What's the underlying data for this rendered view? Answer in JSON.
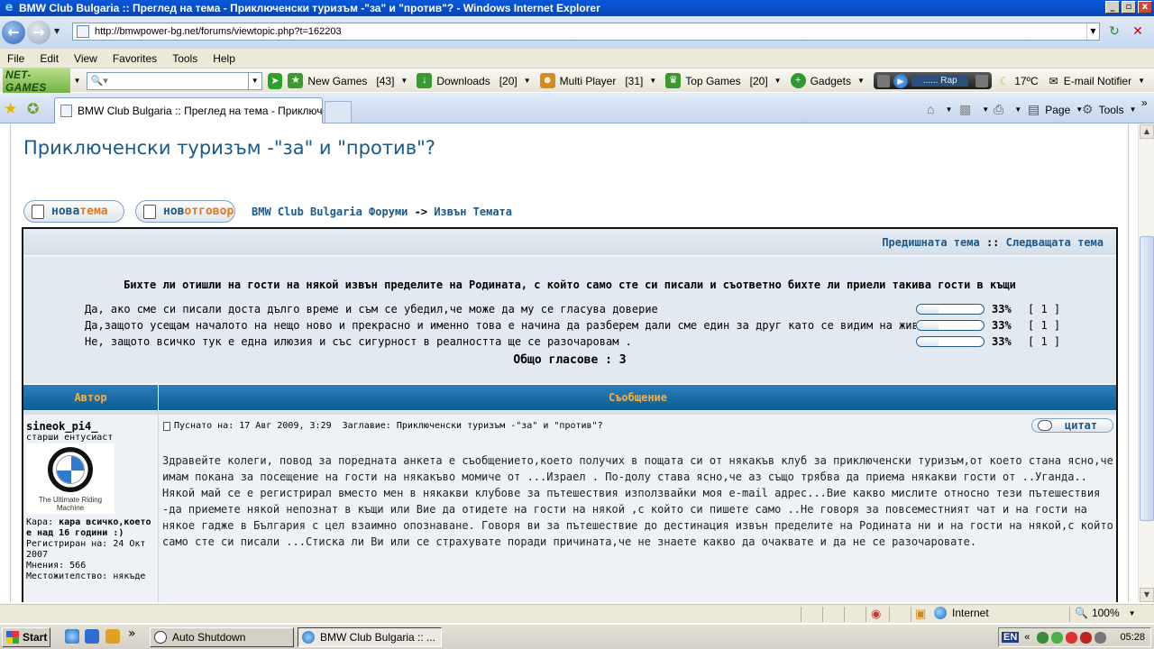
{
  "window": {
    "title": "BMW Club Bulgaria :: Преглед на тема - Приключенски туризъм -\"за\" и \"против\"? - Windows Internet Explorer",
    "controls": [
      "_",
      "▫",
      "x"
    ]
  },
  "address_bar": {
    "url": "http://bmwpower-bg.net/forums/viewtopic.php?t=162203"
  },
  "menu": [
    "File",
    "Edit",
    "View",
    "Favorites",
    "Tools",
    "Help"
  ],
  "toolbar": {
    "brand": "NET-GAMES",
    "search_placeholder": "",
    "items": [
      {
        "label": "New Games",
        "count": "[43]",
        "icon": "new-games-icon",
        "color": "#3b9a2f"
      },
      {
        "label": "Downloads",
        "count": "[20]",
        "icon": "downloads-icon",
        "color": "#3b9a2f"
      },
      {
        "label": "Multi Player",
        "count": "[31]",
        "icon": "multiplayer-icon",
        "color": "#d98a1c"
      },
      {
        "label": "Top Games",
        "count": "[20]",
        "icon": "top-games-icon",
        "color": "#3b9a2f"
      }
    ],
    "gadgets_label": "Gadgets",
    "player_station": "...... Rap",
    "weather": "17ºC",
    "email_label": "E-mail Notifier"
  },
  "tabs": [
    {
      "label": "BMW Club Bulgaria :: Преглед на тема - Приключен..."
    }
  ],
  "command_bar": {
    "page_label": "Page",
    "tools_label": "Tools"
  },
  "forum": {
    "topic_title": "Приключенски туризъм -\"за\" и \"против\"?",
    "new_topic": {
      "part1": "нова",
      "part2": "тема"
    },
    "reply": {
      "part1": "нов",
      "part2": "отговор"
    },
    "breadcrumb_forum": "BMW Club Bulgaria Форуми",
    "breadcrumb_sep": "->",
    "breadcrumb_section": "Извън Темата",
    "prev_topic": "Предишната тема",
    "nav_sep": "::",
    "next_topic": "Следващата тема",
    "poll": {
      "question": "Бихте ли отишли на гости на някой извън пределите на Родината, с който само сте си писали и съответно бихте ли приели такива гости в къщи",
      "options": [
        {
          "text": "Да, ако сме си писали доста дълго време и съм се убедил,че може да му се гласува доверие",
          "percent": "33%",
          "votes": "[ 1 ]",
          "fraction": 0.33
        },
        {
          "text": "Да,защото усещам началото на нещо ново и прекрасно и именно това е начина да разберем дали сме един за друг като се видим на живо",
          "percent": "33%",
          "votes": "[ 1 ]",
          "fraction": 0.33
        },
        {
          "text": "Не, защото всичко тук е една илюзия и със сигурност в реалността ще се разочаровам .",
          "percent": "33%",
          "votes": "[ 1 ]",
          "fraction": 0.33
        }
      ],
      "total": "Общо гласове : 3"
    },
    "columns": {
      "author": "Автор",
      "message": "Съобщение"
    },
    "post": {
      "username": "sineok_pi4_",
      "rank": "старши ентусиаст",
      "avatar_caption": "The Ultimate Riding Machine",
      "car_label": "Кара:",
      "car_value": "кара всичко,което е над 16 години :)",
      "registered": "Регистриран на: 24 Окт 2007",
      "posts": "Мнения: 566",
      "location": "Местожителство: някъде",
      "posted": "Пуснато на: 17 Авг 2009, 3:29",
      "subject": "Заглавие: Приключенски туризъм -\"за\" и \"против\"?",
      "quote_label": "цитат",
      "body": "Здравейте колеги, повод за поредната анкета е съобщението,което получих в пощата си от някакъв клуб за приключенски туризъм,от което стана ясно,че имам покана за посещение на гости на някакъво момиче от ...Израел . По-долу става ясно,че аз също трябва да приема някакви гости от ..Уганда.. Някой май се е регистрирал вместо мен в някакви клубове за пътешествия използвайки моя e-mail адрес...Вие какво мислите относно тези пътешествия -да приемете някой непознат в къщи или Вие да отидете на гости на някой ,с който си пишете само ..Не говоря за повсеместният чат и на гости на някое гадже в България с цел взаимно опознаване. Говоря ви за пътешествие до дестинация извън пределите на Родината ни и на гости на някой,с който само сте си писали ...Стиска ли Ви или се страхувате поради причината,че не знаете какво да очаквате и да не се разочаровате."
    }
  },
  "statusbar": {
    "zone": "Internet",
    "zoom": "100%"
  },
  "taskbar": {
    "start": "Start",
    "tasks": [
      "Auto Shutdown",
      "BMW Club Bulgaria :: ..."
    ],
    "lang": "EN",
    "clock": "05:28"
  }
}
